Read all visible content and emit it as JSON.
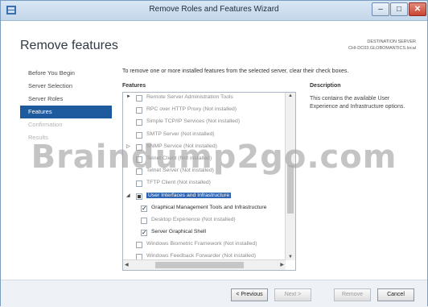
{
  "window": {
    "title": "Remove Roles and Features Wizard",
    "min": "–",
    "max": "□",
    "close": "✕"
  },
  "heading": "Remove features",
  "destination": {
    "label": "DESTINATION SERVER",
    "server": "CHI-DC03.GLOBOMANTICS.local"
  },
  "nav": [
    {
      "label": "Before You Begin",
      "state": "normal"
    },
    {
      "label": "Server Selection",
      "state": "normal"
    },
    {
      "label": "Server Roles",
      "state": "normal"
    },
    {
      "label": "Features",
      "state": "active"
    },
    {
      "label": "Confirmation",
      "state": "disabled"
    },
    {
      "label": "Results",
      "state": "disabled"
    }
  ],
  "instructions": "To remove one or more installed features from the selected server, clear their check boxes.",
  "features_header": "Features",
  "description_header": "Description",
  "description_text": "This contains the available User Experience and Infrastructure options.",
  "features": [
    {
      "label": "Remote Server Administration Tools",
      "checked": false,
      "indent": 1,
      "expand": "►",
      "state": "partial"
    },
    {
      "label": "RPC over HTTP Proxy (Not installed)",
      "checked": false,
      "indent": 1,
      "state": "normal"
    },
    {
      "label": "Simple TCP/IP Services (Not installed)",
      "checked": false,
      "indent": 1,
      "state": "normal"
    },
    {
      "label": "SMTP Server (Not installed)",
      "checked": false,
      "indent": 1,
      "state": "normal"
    },
    {
      "label": "SNMP Service (Not installed)",
      "checked": false,
      "indent": 1,
      "expand": "▷",
      "state": "normal"
    },
    {
      "label": "Telnet Client (Not installed)",
      "checked": false,
      "indent": 1,
      "state": "normal"
    },
    {
      "label": "Telnet Server (Not installed)",
      "checked": false,
      "indent": 1,
      "state": "normal"
    },
    {
      "label": "TFTP Client (Not installed)",
      "checked": false,
      "indent": 1,
      "state": "normal"
    },
    {
      "label": "User Interfaces and Infrastructure",
      "checked": "partial",
      "indent": 1,
      "expand": "◢",
      "state": "selected"
    },
    {
      "label": "Graphical Management Tools and Infrastructure",
      "checked": true,
      "indent": 2,
      "state": "normal"
    },
    {
      "label": "Desktop Experience (Not installed)",
      "checked": false,
      "indent": 2,
      "state": "normal"
    },
    {
      "label": "Server Graphical Shell",
      "checked": true,
      "indent": 2,
      "state": "normal"
    },
    {
      "label": "Windows Biometric Framework (Not installed)",
      "checked": false,
      "indent": 1,
      "state": "normal"
    },
    {
      "label": "Windows Feedback Forwarder (Not installed)",
      "checked": false,
      "indent": 1,
      "state": "normal"
    }
  ],
  "buttons": {
    "previous": "< Previous",
    "next": "Next >",
    "remove": "Remove",
    "cancel": "Cancel"
  },
  "watermark": "Braindump2go.com",
  "colors": {
    "active_nav": "#1e5a9e",
    "selection": "#2d64b3"
  }
}
